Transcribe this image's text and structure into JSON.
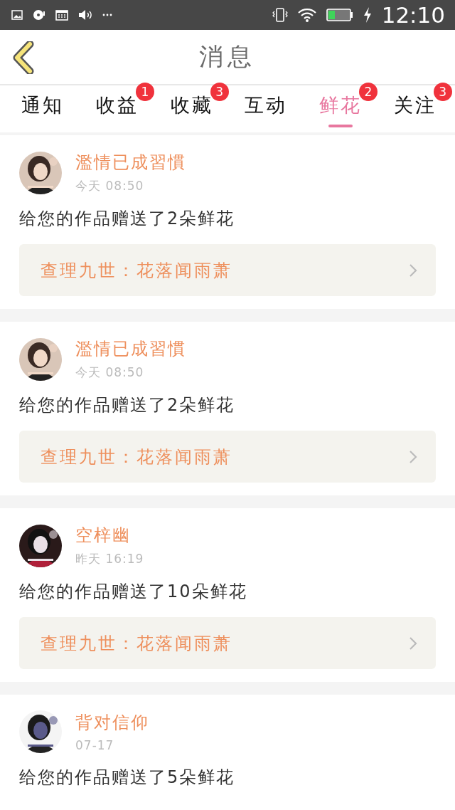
{
  "status_bar": {
    "time": "12:10"
  },
  "header": {
    "title": "消息"
  },
  "tabs": [
    {
      "label": "通知",
      "selected": false
    },
    {
      "label": "收益",
      "badge": "1",
      "selected": false
    },
    {
      "label": "收藏",
      "badge": "3",
      "selected": false
    },
    {
      "label": "互动",
      "selected": false
    },
    {
      "label": "鲜花",
      "badge": "2",
      "selected": true
    },
    {
      "label": "关注",
      "badge": "3",
      "selected": false
    }
  ],
  "messages": [
    {
      "name": "濫情已成習慣",
      "time": "今天 08:50",
      "text": "给您的作品赠送了2朵鲜花",
      "work": "查理九世：花落闻雨萧"
    },
    {
      "name": "濫情已成習慣",
      "time": "今天 08:50",
      "text": "给您的作品赠送了2朵鲜花",
      "work": "查理九世：花落闻雨萧"
    },
    {
      "name": "空梓幽",
      "time": "昨天 16:19",
      "text": "给您的作品赠送了10朵鲜花",
      "work": "查理九世：花落闻雨萧"
    },
    {
      "name": "背对信仰",
      "time": "07-17",
      "text": "给您的作品赠送了5朵鲜花"
    }
  ]
}
